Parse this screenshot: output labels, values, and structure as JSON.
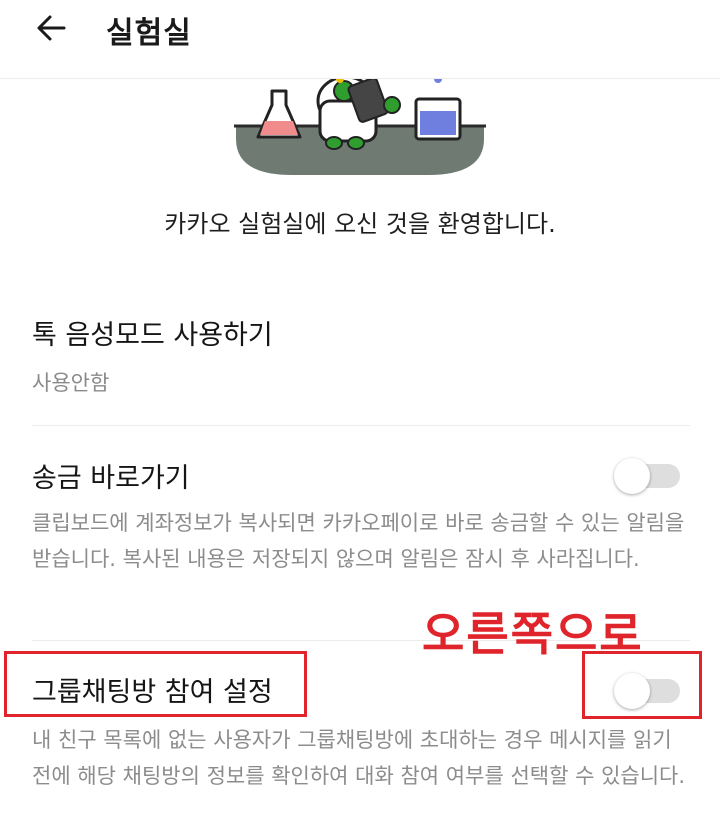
{
  "header": {
    "title": "실험실"
  },
  "welcome": "카카오 실험실에 오신 것을 환영합니다.",
  "settings": [
    {
      "title": "톡 음성모드 사용하기",
      "value": "사용안함"
    },
    {
      "title": "송금 바로가기",
      "description": "클립보드에 계좌정보가 복사되면 카카오페이로 바로 송금할 수 있는 알림을 받습니다. 복사된 내용은 저장되지 않으며 알림은 잠시 후 사라집니다.",
      "enabled": false
    },
    {
      "title": "그룹채팅방 참여 설정",
      "description": "내 친구 목록에 없는 사용자가 그룹채팅방에 초대하는 경우 메시지를 읽기 전에 해당 채팅방의 정보를 확인하여 대화 참여 여부를 선택할 수 있습니다.",
      "enabled": false
    }
  ],
  "annotation": {
    "text": "오른쪽으로",
    "color": "#e0242b"
  },
  "colors": {
    "toggle_off": "#dedede",
    "flask_pink": "#f08c8c",
    "beaker_blue": "#6f7fe0",
    "plate": "#6f7a73"
  }
}
